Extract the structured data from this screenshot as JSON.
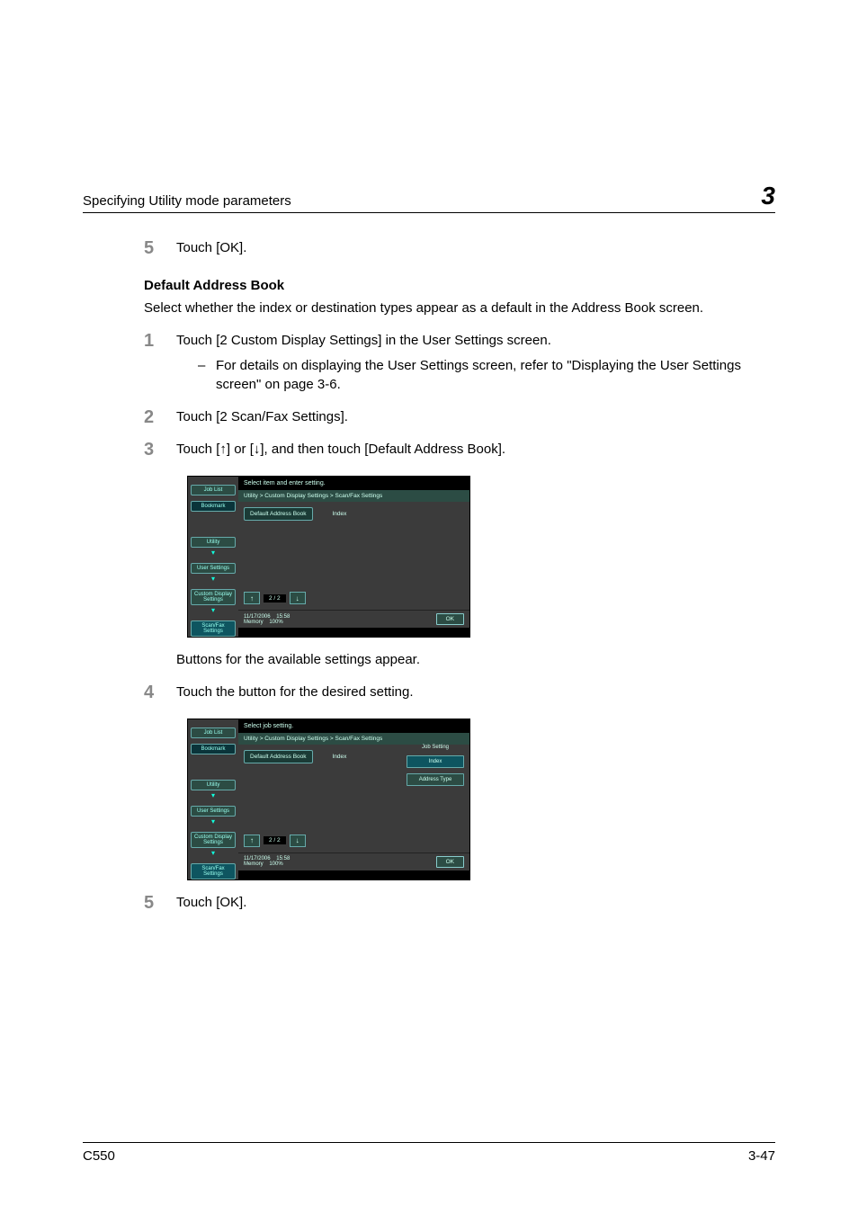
{
  "header": {
    "title": "Specifying Utility mode parameters",
    "chapter": "3"
  },
  "steps": {
    "step5a": {
      "num": "5",
      "text": "Touch [OK]."
    },
    "subheading": "Default Address Book",
    "intro": "Select whether the index or destination types appear as a default in the Address Book screen.",
    "step1": {
      "num": "1",
      "text": "Touch [2 Custom Display Settings] in the User Settings screen.",
      "bullet": "For details on displaying the User Settings screen, refer to \"Displaying the User Settings screen\" on page 3-6."
    },
    "step2": {
      "num": "2",
      "text": "Touch [2 Scan/Fax Settings]."
    },
    "step3": {
      "num": "3",
      "text": "Touch [↑] or [↓], and then touch [Default Address Book]."
    },
    "after_shot1": "Buttons for the available settings appear.",
    "step4": {
      "num": "4",
      "text": "Touch the button for the desired setting."
    },
    "step5b": {
      "num": "5",
      "text": "Touch [OK]."
    }
  },
  "shot": {
    "sidebar": {
      "job_list": "Job List",
      "bookmark": "Bookmark",
      "utility": "Utility",
      "user_settings": "User Settings",
      "custom_display": "Custom Display\nSettings",
      "scan_fax": "Scan/Fax\nSettings"
    },
    "title1": "Select item and enter setting.",
    "title2": "Select job setting.",
    "crumb": "Utility > Custom Display Settings > Scan/Fax Settings",
    "btn_default": "Default Address Book",
    "val_index": "Index",
    "pager": "2 / 2",
    "status_date": "11/17/2006",
    "status_time": "15:58",
    "status_mem": "Memory",
    "status_pct": "100%",
    "ok": "OK",
    "side_title": "Job Setting",
    "side_index": "Index",
    "side_addr": "Address Type"
  },
  "footer": {
    "left": "C550",
    "right": "3-47"
  }
}
